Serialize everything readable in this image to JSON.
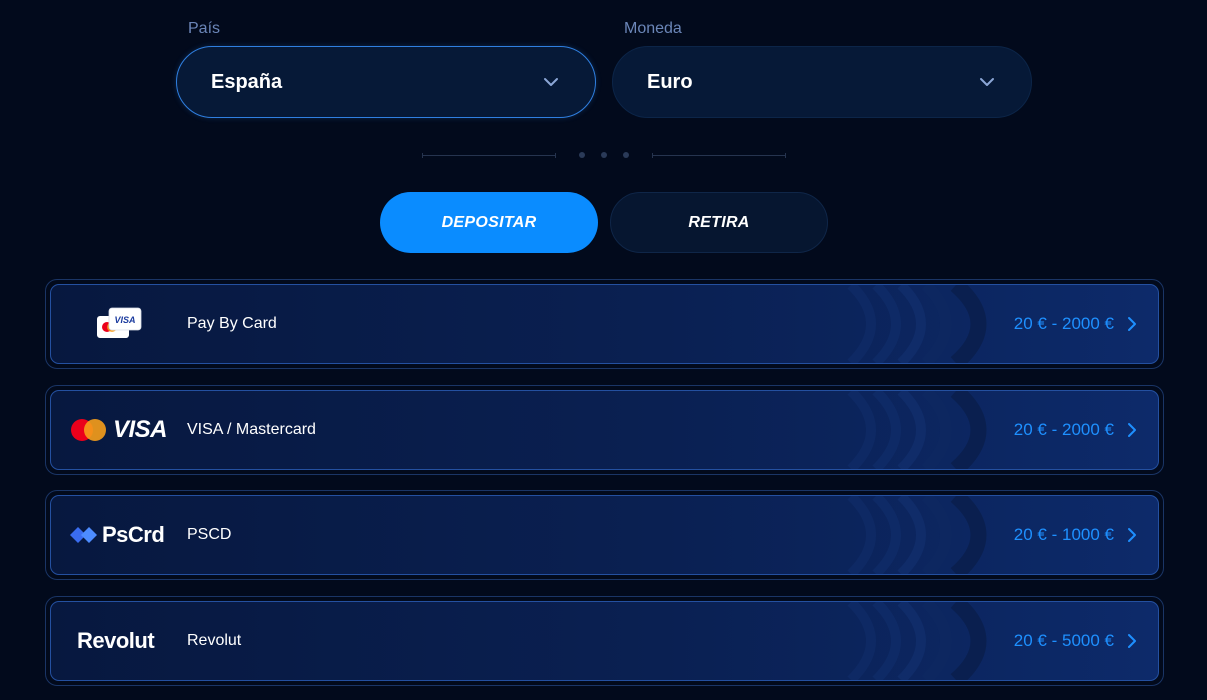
{
  "selectors": {
    "country": {
      "label": "País",
      "value": "España"
    },
    "currency": {
      "label": "Moneda",
      "value": "Euro"
    }
  },
  "tabs": {
    "deposit": "DEPOSITAR",
    "withdraw": "RETIRA",
    "active": "deposit"
  },
  "methods": [
    {
      "name": "Pay By Card",
      "range": "20 € - 2000 €",
      "logo": "card-stack-icon",
      "logo_text": "VISA"
    },
    {
      "name": "VISA / Mastercard",
      "range": "20 € - 2000 €",
      "logo": "visa-mastercard-logo",
      "logo_text": "VISA"
    },
    {
      "name": "PSCD",
      "range": "20 € - 1000 €",
      "logo": "pscrd-logo",
      "logo_text": "PsCrd"
    },
    {
      "name": "Revolut",
      "range": "20 € - 5000 €",
      "logo": "revolut-logo",
      "logo_text": "Revolut"
    }
  ],
  "colors": {
    "background": "#020a1c",
    "accent": "#0a8cff",
    "range_text": "#1e90ff",
    "label": "#6b86b8"
  }
}
